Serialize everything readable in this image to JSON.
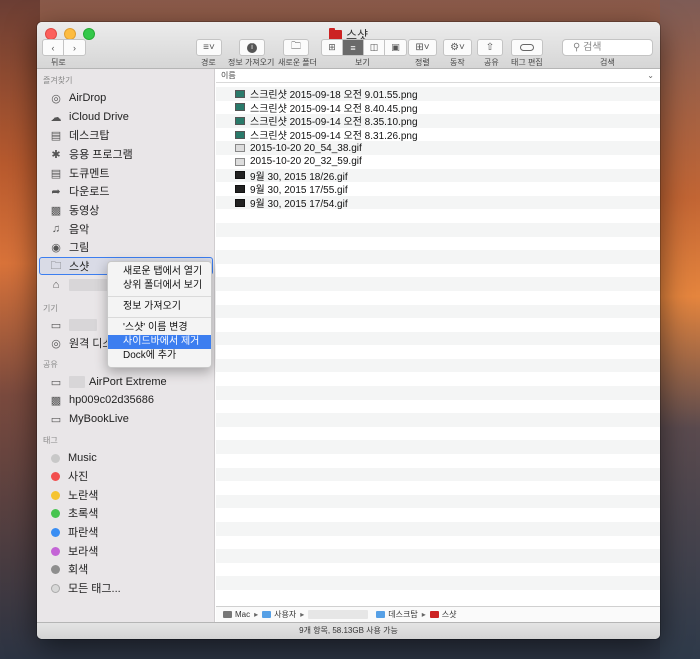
{
  "window": {
    "title": "스샷"
  },
  "toolbar": {
    "back_label": "뒤로",
    "path_label": "경로",
    "info_label": "정보 가져오기",
    "new_folder_label": "새로운 폴더",
    "view_label": "보기",
    "arrange_label": "정렬",
    "action_label": "동작",
    "share_label": "공유",
    "tag_edit_label": "태그 편집",
    "search_label": "검색",
    "search_placeholder": "검색"
  },
  "sidebar": {
    "favorites_header": "즐겨찾기",
    "favorites": [
      {
        "label": "AirDrop",
        "icon": "airdrop-icon"
      },
      {
        "label": "iCloud Drive",
        "icon": "cloud-icon"
      },
      {
        "label": "데스크탑",
        "icon": "desktop-icon"
      },
      {
        "label": "응용 프로그램",
        "icon": "applications-icon"
      },
      {
        "label": "도큐멘트",
        "icon": "document-icon"
      },
      {
        "label": "다운로드",
        "icon": "download-icon"
      },
      {
        "label": "동영상",
        "icon": "movie-icon"
      },
      {
        "label": "음악",
        "icon": "music-icon"
      },
      {
        "label": "그림",
        "icon": "camera-icon"
      },
      {
        "label": "스샷",
        "icon": "folder-icon"
      }
    ],
    "devices_header": "기기",
    "remote_disc_label": "원격 디스크",
    "shared_header": "공유",
    "shared": [
      {
        "label": "AirPort Extreme",
        "icon": "disk-icon"
      },
      {
        "label": "hp009c02d35686",
        "icon": "monitor-icon"
      },
      {
        "label": "MyBookLive",
        "icon": "monitor-icon"
      }
    ],
    "tags_header": "태그",
    "tags": [
      {
        "label": "Music",
        "color": "#c8c8c8"
      },
      {
        "label": "사진",
        "color": "#f24e4e"
      },
      {
        "label": "노란색",
        "color": "#f5c431"
      },
      {
        "label": "초록색",
        "color": "#47c450"
      },
      {
        "label": "파란색",
        "color": "#3a8ef3"
      },
      {
        "label": "보라색",
        "color": "#c465d6"
      },
      {
        "label": "회색",
        "color": "#8e8e8e"
      },
      {
        "label": "모든 태그...",
        "color": "#d8d8d8"
      }
    ]
  },
  "context_menu": {
    "items": [
      "새로운 탭에서 열기",
      "상위 폴더에서 보기",
      "정보 가져오기",
      "'스샷' 이름 변경",
      "사이드바에서 제거",
      "Dock에 추가"
    ]
  },
  "file_list": {
    "column_header": "이름",
    "files": [
      {
        "name": "스크린샷 2015-09-18 오전 9.01.55.png",
        "type": "png"
      },
      {
        "name": "스크린샷 2015-09-14 오전 8.40.45.png",
        "type": "png"
      },
      {
        "name": "스크린샷 2015-09-14 오전 8.35.10.png",
        "type": "png"
      },
      {
        "name": "스크린샷 2015-09-14 오전 8.31.26.png",
        "type": "png"
      },
      {
        "name": "2015-10-20 20_54_38.gif",
        "type": "gif"
      },
      {
        "name": "2015-10-20 20_32_59.gif",
        "type": "gif"
      },
      {
        "name": "9월 30, 2015 18/26.gif",
        "type": "dark"
      },
      {
        "name": "9월 30, 2015 17/55.gif",
        "type": "dark"
      },
      {
        "name": "9월 30, 2015 17/54.gif",
        "type": "dark"
      }
    ]
  },
  "path_bar": {
    "mac": "Mac",
    "users": "사용자",
    "desktop": "데스크탑",
    "folder": "스샷"
  },
  "status": {
    "text": "9개 항목, 58.13GB 사용 가능"
  }
}
